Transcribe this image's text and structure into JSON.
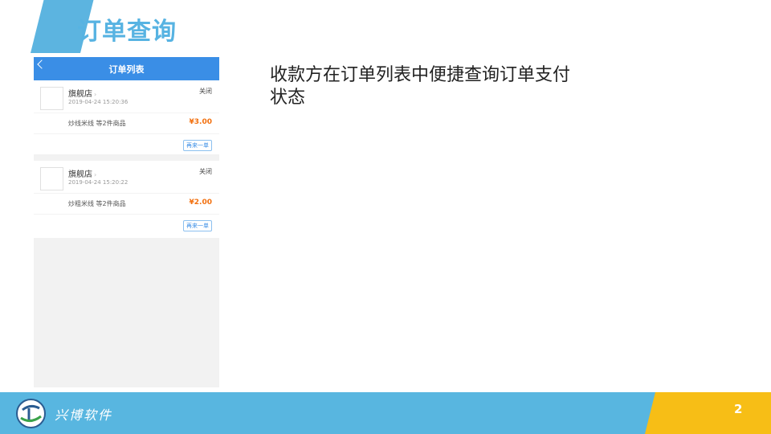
{
  "slide": {
    "title": "订单查询",
    "description": "收款方在订单列表中便捷查询订单支付状态",
    "page_number": "2"
  },
  "phone": {
    "header_title": "订单列表",
    "orders": [
      {
        "store": "旗舰店",
        "time": "2019-04-24 15:20:36",
        "status": "关闭",
        "items": "炒线米线 等2件商品",
        "price": "¥3.00",
        "action": "再来一单"
      },
      {
        "store": "旗舰店",
        "time": "2019-04-24 15:20:22",
        "status": "关闭",
        "items": "炒粗米线 等2件商品",
        "price": "¥2.00",
        "action": "再来一单"
      }
    ]
  },
  "footer": {
    "company": "兴博软件"
  },
  "colors": {
    "accent_blue": "#58b6e0",
    "header_blue": "#3a8ee6",
    "gold": "#f7be16",
    "price_orange": "#f2700f"
  }
}
